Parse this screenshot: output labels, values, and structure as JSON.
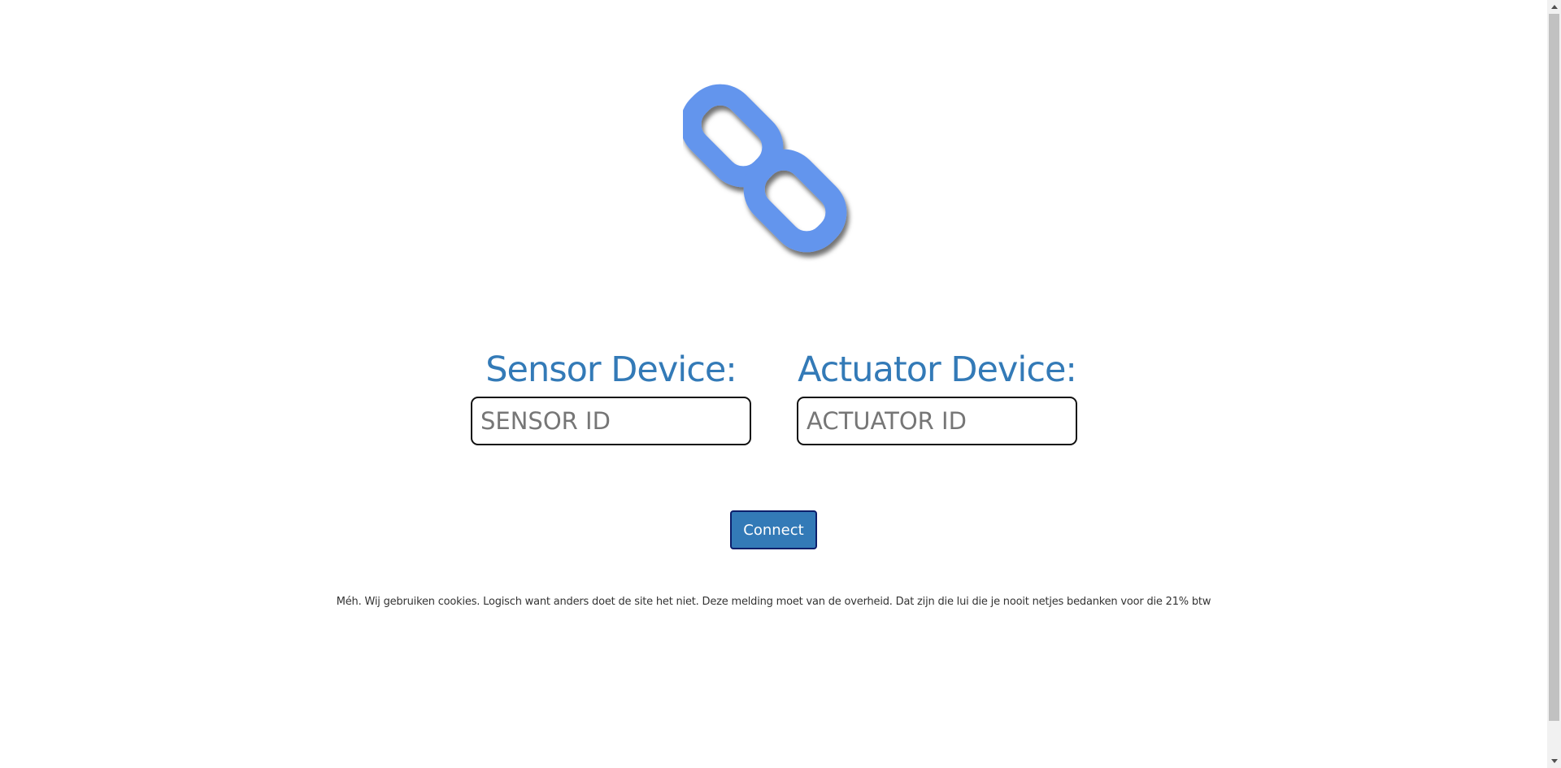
{
  "logo": {
    "icon": "chain-link-icon",
    "color": "#6495ed"
  },
  "sensor": {
    "label": "Sensor Device:",
    "placeholder": "SENSOR ID",
    "value": ""
  },
  "actuator": {
    "label": "Actuator Device:",
    "placeholder": "ACTUATOR ID",
    "value": ""
  },
  "connect": {
    "label": "Connect"
  },
  "cookie_notice": "Méh. Wij gebruiken cookies. Logisch want anders doet de site het niet. Deze melding moet van de overheid. Dat zijn die lui die je nooit netjes bedanken voor die 21% btw",
  "colors": {
    "accent": "#337ab7",
    "button_border": "#0c1e6b",
    "logo": "#6495ed"
  }
}
